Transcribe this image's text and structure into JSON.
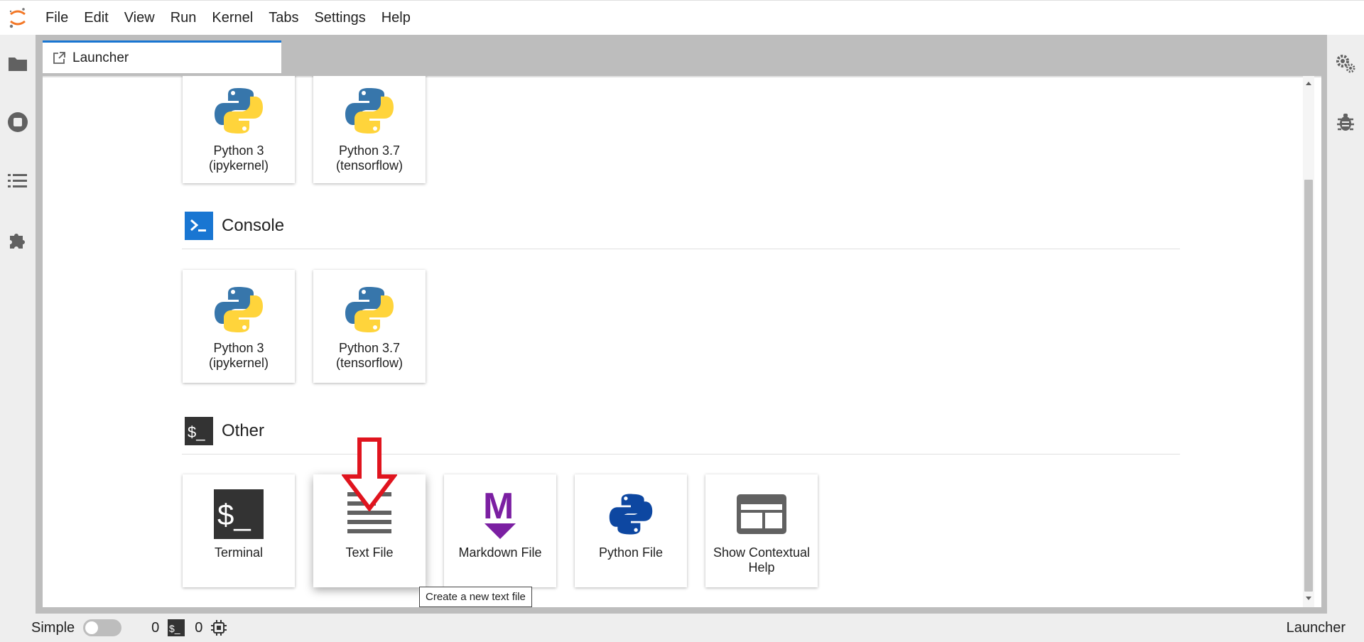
{
  "menubar": {
    "items": [
      "File",
      "Edit",
      "View",
      "Run",
      "Kernel",
      "Tabs",
      "Settings",
      "Help"
    ]
  },
  "tabs": [
    {
      "label": "Launcher"
    }
  ],
  "launcher": {
    "notebook_cards": [
      {
        "label": "Python 3 (ipykernel)"
      },
      {
        "label": "Python 3.7 (tensorflow)"
      }
    ],
    "console_section": {
      "title": "Console",
      "cards": [
        {
          "label": "Python 3 (ipykernel)"
        },
        {
          "label": "Python 3.7 (tensorflow)"
        }
      ]
    },
    "other_section": {
      "title": "Other",
      "cards": [
        {
          "label": "Terminal"
        },
        {
          "label": "Text File"
        },
        {
          "label": "Markdown File"
        },
        {
          "label": "Python File"
        },
        {
          "label": "Show Contextual Help"
        }
      ]
    },
    "tooltip": "Create a new text file",
    "markdown_visible_fragment": "le"
  },
  "statusbar": {
    "mode_label": "Simple",
    "kernels_count": "0",
    "terminals_count": "0",
    "active_doc": "Launcher"
  },
  "colors": {
    "jupyter_orange": "#F37726",
    "console_blue": "#1976d2",
    "markdown_purple": "#7B1FA2",
    "python_blue": "#0D47A1",
    "annotation_red": "#E0141E"
  }
}
